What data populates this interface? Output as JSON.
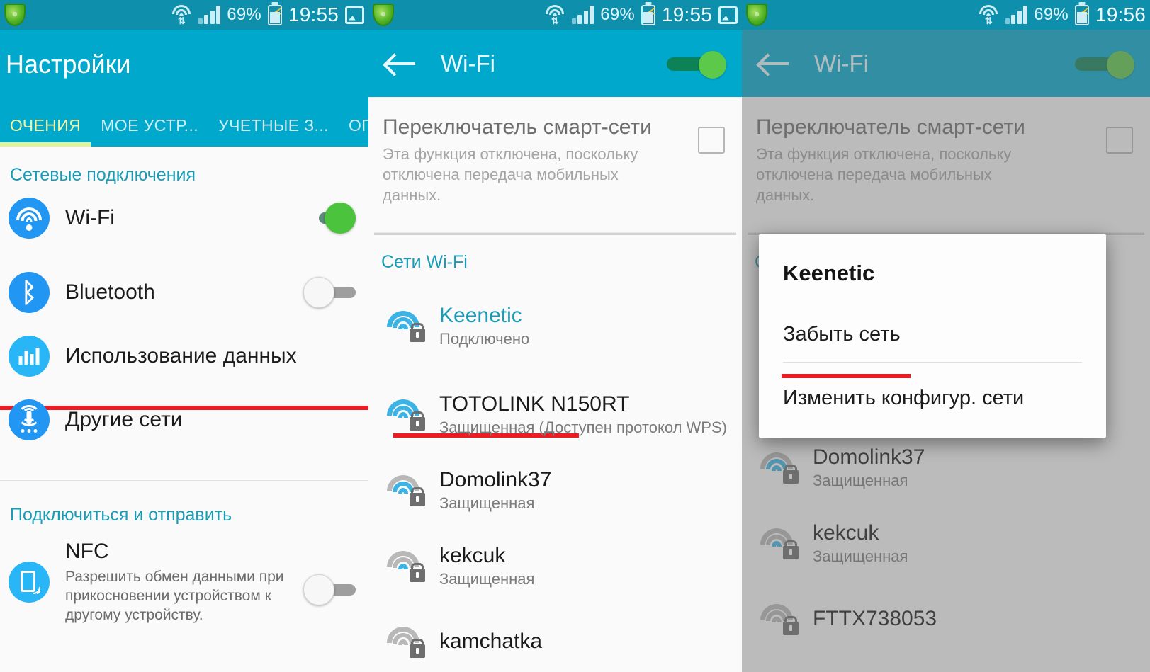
{
  "statusbar": {
    "battery_percent": "69%",
    "time_left": "19:55",
    "time_mid": "19:55",
    "time_right": "19:56",
    "icons": [
      "shield-icon",
      "gallery-icon",
      "wifi-signal-icon",
      "cell-signal-icon",
      "battery-charging-icon"
    ]
  },
  "left_panel": {
    "title": "Настройки",
    "tabs": [
      {
        "label": "ОЧЕНИЯ",
        "active": true
      },
      {
        "label": "МОЕ УСТР...",
        "active": false
      },
      {
        "label": "УЧЕТНЫЕ З...",
        "active": false
      },
      {
        "label": "ОПЦИИ",
        "active": false
      }
    ],
    "sections": [
      {
        "header": "Сетевые подключения",
        "items": [
          {
            "label": "Wi-Fi",
            "icon": "wifi-icon",
            "toggle": "on",
            "highlighted": true
          },
          {
            "label": "Bluetooth",
            "icon": "bluetooth-icon",
            "toggle": "off"
          },
          {
            "label": "Использование данных",
            "icon": "data-usage-icon"
          },
          {
            "label": "Другие сети",
            "icon": "other-networks-icon"
          }
        ]
      },
      {
        "header": "Подключиться и отправить",
        "items": [
          {
            "label": "NFC",
            "icon": "nfc-icon",
            "toggle": "off",
            "sub": "Разрешить обмен данными при прикосновении устройством к другому устройству."
          }
        ]
      }
    ]
  },
  "mid_panel": {
    "title": "Wi-Fi",
    "back_icon": "back-arrow-icon",
    "wifi_toggle": "on",
    "smart_switch": {
      "title": "Переключатель смарт-сети",
      "sub": "Эта функция отключена, поскольку отключена передача мобильных данных.",
      "checked": false
    },
    "networks_header": "Сети Wi-Fi",
    "networks": [
      {
        "name": "Keenetic",
        "sub": "Подключено",
        "connected": true,
        "strength": 3,
        "secured": true,
        "highlighted": true
      },
      {
        "name": "TOTOLINK N150RT",
        "sub": "Защищенная (Доступен протокол WPS)",
        "strength": 3,
        "secured": true
      },
      {
        "name": "Domolink37",
        "sub": "Защищенная",
        "strength": 2,
        "secured": true
      },
      {
        "name": "kekcuk",
        "sub": "Защищенная",
        "strength": 1,
        "secured": true
      },
      {
        "name": "kamchatka",
        "sub": "",
        "strength": 0,
        "secured": true
      }
    ]
  },
  "right_panel": {
    "title": "Wi-Fi",
    "back_icon": "back-arrow-icon",
    "wifi_toggle": "on",
    "smart_switch": {
      "title": "Переключатель смарт-сети",
      "sub": "Эта функция отключена, поскольку отключена передача мобильных данных.",
      "checked": false
    },
    "networks_header": "Сети Wi-Fi",
    "dialog": {
      "title": "Keenetic",
      "option_forget": "Забыть сеть",
      "option_modify": "Изменить конфигур. сети"
    },
    "networks": [
      {
        "name": "Domolink37",
        "sub": "Защищенная",
        "strength": 2,
        "secured": true
      },
      {
        "name": "kekcuk",
        "sub": "Защищенная",
        "strength": 1,
        "secured": true
      },
      {
        "name": "FTTX738053",
        "sub": "",
        "strength": 0,
        "secured": true
      }
    ]
  },
  "colors": {
    "statusbar": "#0e8fac",
    "appbar": "#00a8cc",
    "accent_teal": "#1a9bb5",
    "active_tab": "#e3f29a",
    "toggle_on": "#4cc33c",
    "highlight_red": "#ec1c24",
    "icon_blue": "#2196f3",
    "wifi_blue": "#3bb4e5"
  }
}
